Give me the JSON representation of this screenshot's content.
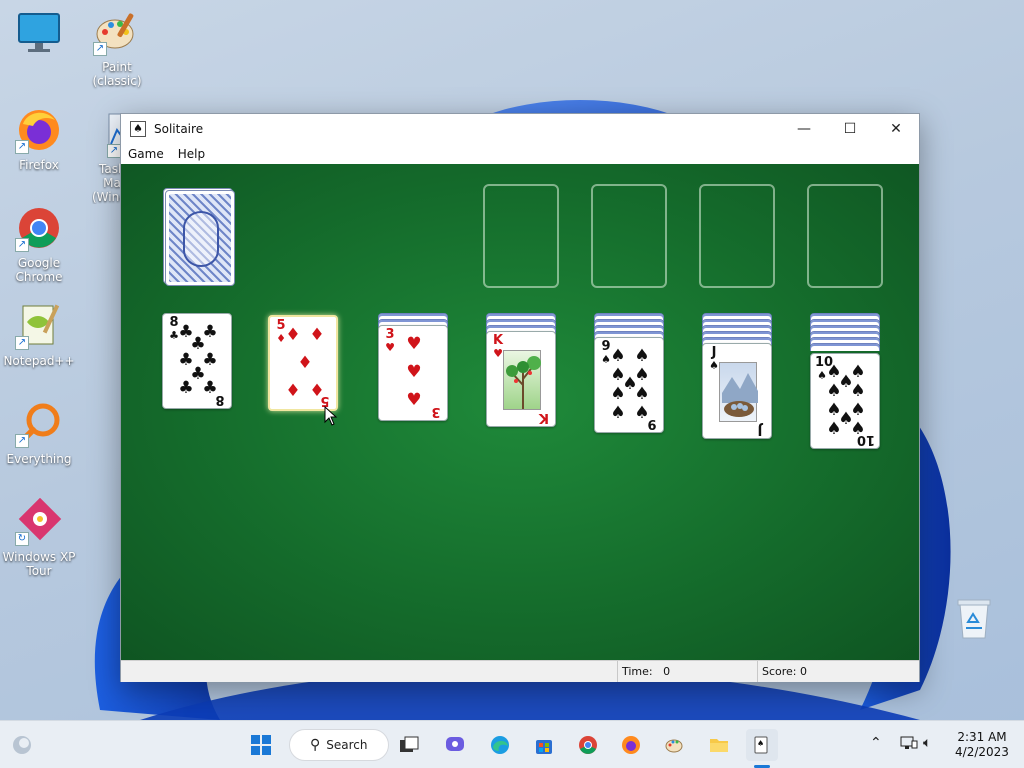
{
  "desktop": {
    "icons": [
      {
        "label": "",
        "icon": "monitor-icon"
      },
      {
        "label": "Paint (classic)",
        "icon": "paint-icon"
      },
      {
        "label": "Firefox",
        "icon": "firefox-icon"
      },
      {
        "label": "Task Ma (Windo",
        "icon": "task-manager-icon"
      },
      {
        "label": "Google Chrome",
        "icon": "chrome-icon"
      },
      {
        "label": "Notepad++",
        "icon": "notepadpp-icon"
      },
      {
        "label": "Everything",
        "icon": "everything-icon"
      },
      {
        "label": "Windows XP Tour",
        "icon": "xp-tour-icon"
      }
    ],
    "recycle_bin_icon": "recycle-bin-icon"
  },
  "window": {
    "title": "Solitaire",
    "menu": [
      "Game",
      "Help"
    ],
    "controls": {
      "minimize": "—",
      "maximize": "☐",
      "close": "✕"
    },
    "status": {
      "time_label": "Time:",
      "time_value": "0",
      "score_label": "Score: 0"
    }
  },
  "game": {
    "tableau": [
      {
        "rank": "8",
        "suit": "♣",
        "color": "black",
        "hidden": 0
      },
      {
        "rank": "5",
        "suit": "♦",
        "color": "red",
        "hidden": 0,
        "selected": true
      },
      {
        "rank": "3",
        "suit": "♥",
        "color": "red",
        "hidden": 2
      },
      {
        "rank": "K",
        "suit": "♥",
        "color": "red",
        "hidden": 3
      },
      {
        "rank": "9",
        "suit": "♠",
        "color": "black",
        "hidden": 4
      },
      {
        "rank": "J",
        "suit": "♠",
        "color": "black",
        "hidden": 5
      },
      {
        "rank": "10",
        "suit": "♠",
        "color": "black",
        "hidden": 6
      }
    ]
  },
  "taskbar": {
    "search_label": "Search",
    "time": "2:31 AM",
    "date": "4/2/2023",
    "apps": [
      "start-icon",
      "task-view-icon",
      "chat-icon",
      "edge-icon",
      "store-icon",
      "chrome-icon",
      "firefox-icon",
      "paint-icon",
      "explorer-icon",
      "solitaire-icon"
    ]
  }
}
